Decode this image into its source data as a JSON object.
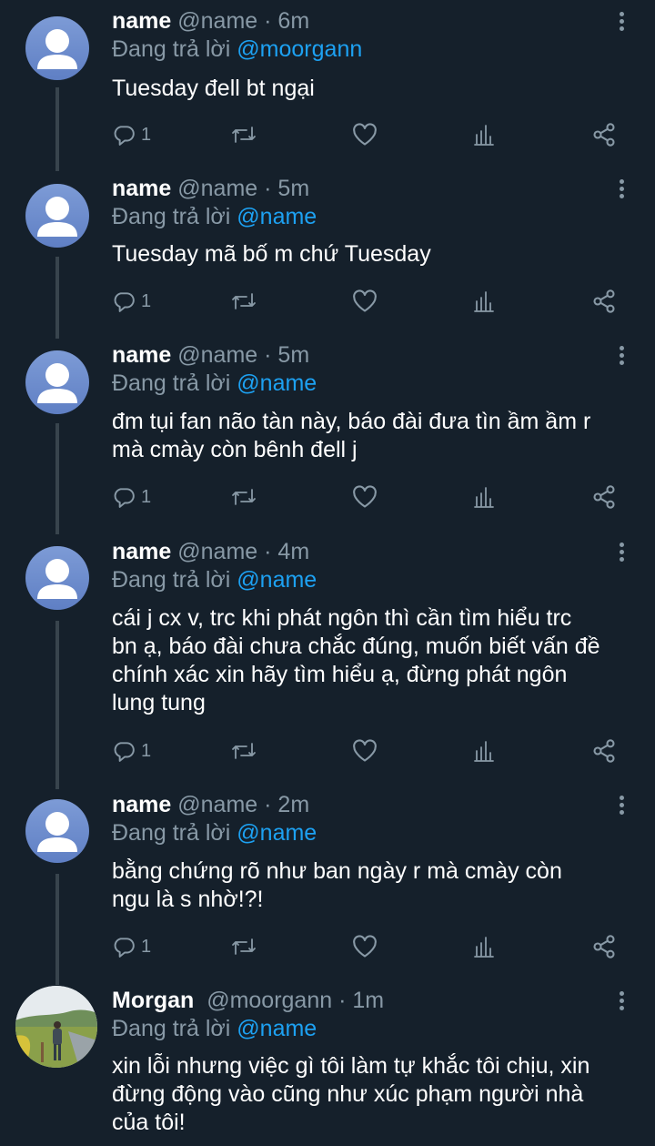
{
  "tweets": [
    {
      "name": "name",
      "handle": "@name",
      "sep": "·",
      "time": "6m",
      "reply_prefix": "Đang trả lời",
      "reply_to": "@moorgann",
      "lines": [
        "Tuesday đell bt ngại"
      ],
      "reply_count": "1"
    },
    {
      "name": "name",
      "handle": "@name",
      "sep": "·",
      "time": "5m",
      "reply_prefix": "Đang trả lời",
      "reply_to": "@name",
      "lines": [
        "Tuesday mã bố m chứ Tuesday"
      ],
      "reply_count": "1"
    },
    {
      "name": "name",
      "handle": "@name",
      "sep": "·",
      "time": "5m",
      "reply_prefix": "Đang trả lời",
      "reply_to": "@name",
      "lines": [
        "đm tụi fan não tàn này, báo đài đưa tìn ầm ầm r",
        "mà cmày còn bênh đell j"
      ],
      "reply_count": "1"
    },
    {
      "name": "name",
      "handle": "@name",
      "sep": "·",
      "time": "4m",
      "reply_prefix": "Đang trả lời",
      "reply_to": "@name",
      "lines": [
        "cái j cx v, trc khi phát ngôn thì cần tìm hiểu trc",
        "bn ạ, báo đài chưa chắc đúng, muốn biết vấn đề",
        "chính xác xin hãy tìm hiểu ạ, đừng phát ngôn",
        "lung tung"
      ],
      "reply_count": "1"
    },
    {
      "name": "name",
      "handle": "@name",
      "sep": "·",
      "time": "2m",
      "reply_prefix": "Đang trả lời",
      "reply_to": "@name",
      "lines": [
        "bằng chứng rõ như ban ngày r mà cmày còn",
        "ngu là s nhờ!?!"
      ],
      "reply_count": "1"
    },
    {
      "name": "Morgan",
      "handle": "@moorgann",
      "sep": "·",
      "time": "1m",
      "reply_prefix": "Đang trả lời",
      "reply_to": "@name",
      "lines": [
        "xin lỗi nhưng việc gì tôi làm tự khắc tôi chịu, xin",
        "đừng động vào cũng như xúc phạm người nhà",
        "của tôi!"
      ]
    }
  ],
  "icons": {
    "reply": "reply-icon",
    "retweet": "retweet-icon",
    "like": "heart-icon",
    "stats": "stats-icon",
    "share": "share-icon",
    "more": "more-vertical-icon"
  },
  "colors": {
    "background": "#15202b",
    "secondary_text": "#8899a6",
    "mention": "#1da1f2",
    "thread_line": "#38444d"
  }
}
